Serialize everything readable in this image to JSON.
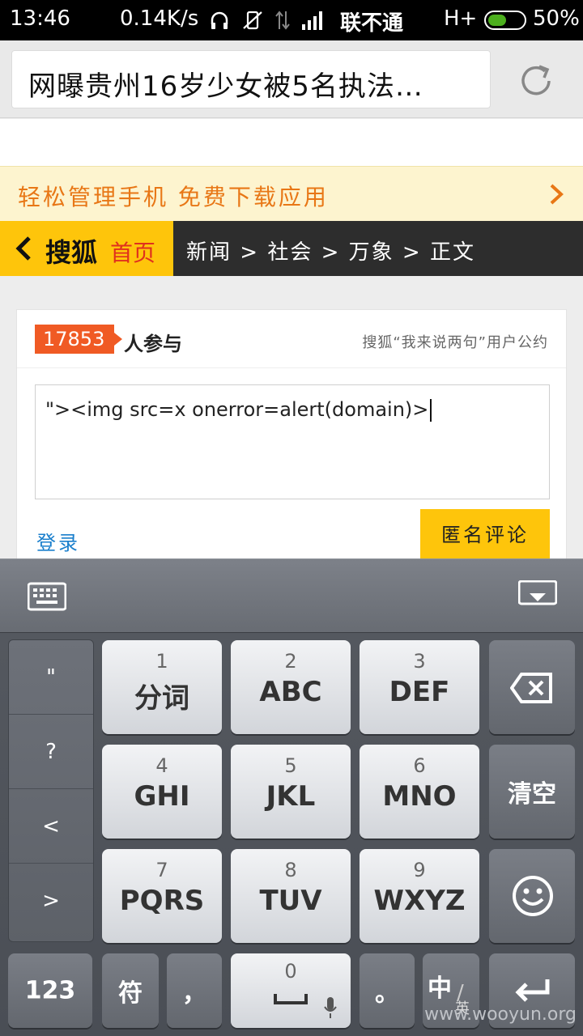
{
  "status_bar": {
    "time": "13:46",
    "speed": "0.14K/s",
    "carrier": "联不通",
    "network": "H+",
    "battery_pct": "50%",
    "battery_level": 0.5
  },
  "browser": {
    "url_title": "网曝贵州16岁少女被5名执法…"
  },
  "promo": {
    "text": "轻松管理手机 免费下载应用"
  },
  "nav": {
    "brand": "搜狐",
    "home": "首页",
    "breadcrumb": "新闻 > 社会 > 万象 > 正文"
  },
  "comment": {
    "count": "17853",
    "participants_label": "人参与",
    "convention_link": "搜狐“我来说两句”用户公约",
    "input_value": "\"><img src=x onerror=alert(domain)>",
    "login_label": "登录",
    "anon_button": "匿名评论"
  },
  "keyboard": {
    "side_keys": [
      "\"",
      "?",
      "<",
      ">"
    ],
    "keys": [
      {
        "num": "1",
        "label": "分词"
      },
      {
        "num": "2",
        "label": "ABC"
      },
      {
        "num": "3",
        "label": "DEF"
      },
      {
        "num": "4",
        "label": "GHI"
      },
      {
        "num": "5",
        "label": "JKL"
      },
      {
        "num": "6",
        "label": "MNO"
      },
      {
        "num": "7",
        "label": "PQRS"
      },
      {
        "num": "8",
        "label": "TUV"
      },
      {
        "num": "9",
        "label": "WXYZ"
      }
    ],
    "clear": "清空",
    "num_mode": "123",
    "symbols": "符",
    "comma": "，",
    "space_num": "0",
    "period": "。",
    "lang_cn": "中",
    "lang_en": "英"
  },
  "watermark": "www.wooyun.org",
  "colors": {
    "sohu_yellow": "#fec50b",
    "badge_orange": "#f05a24",
    "promo_orange": "#e87716",
    "link_blue": "#1a7fcc"
  }
}
